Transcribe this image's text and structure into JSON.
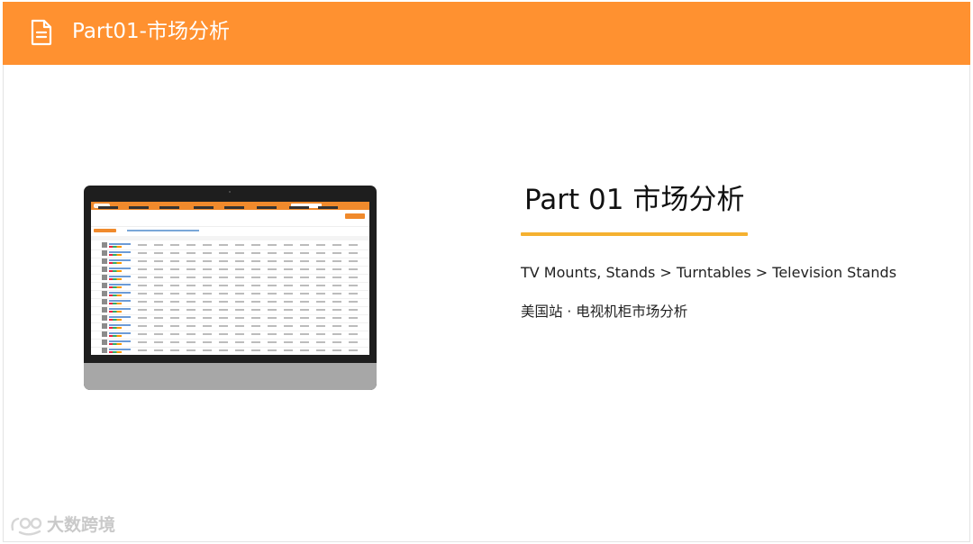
{
  "header": {
    "title": "Part01-市场分析",
    "icon": "document-icon",
    "background_color": "#ff9130"
  },
  "main": {
    "part_title": "Part 01  市场分析",
    "accent_rule_color": "#f5b130",
    "category_path": "TV Mounts, Stands  >  Turntables  > Television Stands",
    "subtitle": "美国站 · 电视机柜市场分析"
  },
  "mockup": {
    "type": "monitor-screenshot",
    "description_icon": "dashboard-screenshot-image"
  },
  "watermark": {
    "text": "大数跨境",
    "icon": "brand-logo-icon"
  }
}
